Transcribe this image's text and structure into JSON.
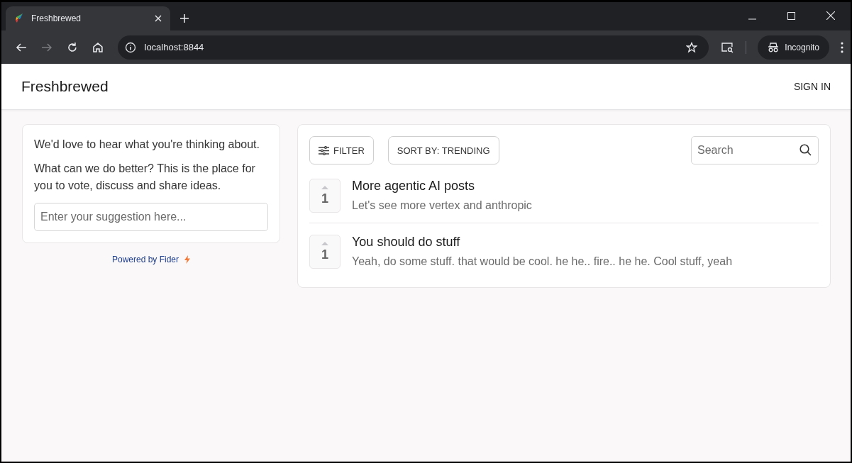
{
  "browser": {
    "tabs": [
      {
        "title": "Freshbrewed",
        "selected": true
      }
    ],
    "nav": [
      {
        "kind": "back",
        "disabled": false
      },
      {
        "kind": "forward",
        "disabled": true
      },
      {
        "kind": "reload",
        "disabled": false
      },
      {
        "kind": "home",
        "disabled": false
      }
    ],
    "address": "localhost:8844",
    "profile": "Incognito"
  },
  "header": {
    "site_title": "Freshbrewed",
    "sign_in": "SIGN IN"
  },
  "sidebar": {
    "paragraphs": [
      "We'd love to hear what you're thinking about.",
      "What can we do better? This is the place for you to vote, discuss and share ideas."
    ],
    "suggestion_field": {
      "placeholder": "Enter your suggestion here..."
    },
    "powered_by": "Powered by Fider"
  },
  "toolbar": {
    "filter": "FILTER",
    "sort": "SORT BY: TRENDING",
    "search": {
      "placeholder": "Search"
    }
  },
  "posts": [
    {
      "votes": "1",
      "title": "More agentic AI posts",
      "description": "Let's see more vertex and anthropic"
    },
    {
      "votes": "1",
      "title": "You should do stuff",
      "description": "Yeah, do some stuff. that would be cool. he he.. fire.. he he. Cool stuff, yeah"
    }
  ]
}
